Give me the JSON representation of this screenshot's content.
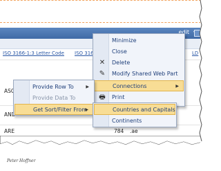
{
  "toolbar": {
    "edit": "edit"
  },
  "columns": {
    "col1": "ISO 3166-1:3 Letter Code",
    "col2": "ISO 316",
    "col3": "LD"
  },
  "rows": [
    {
      "code": "ASC"
    },
    {
      "code": "AND"
    },
    {
      "code": "ARE",
      "num": "784",
      "tld": ".ae"
    }
  ],
  "webpart_menu": {
    "items": [
      {
        "label": "Minimize"
      },
      {
        "label": "Close"
      },
      {
        "label": "Delete"
      },
      {
        "label": "Modify Shared Web Part"
      },
      {
        "label": "Connections"
      },
      {
        "label": "Print"
      }
    ]
  },
  "connections_menu": {
    "items": [
      {
        "label": "Provide Row To"
      },
      {
        "label": "Provide Data To"
      },
      {
        "label": "Get Sort/Filter From"
      }
    ]
  },
  "sortfilter_menu": {
    "items": [
      {
        "label": "Countries and Capitals"
      },
      {
        "label": "Continents"
      }
    ]
  },
  "signature": "Peter Hoffner",
  "colors": {
    "highlight": "#f8dd95",
    "titlebar": "#4a76b3",
    "link": "#2a57a5"
  }
}
